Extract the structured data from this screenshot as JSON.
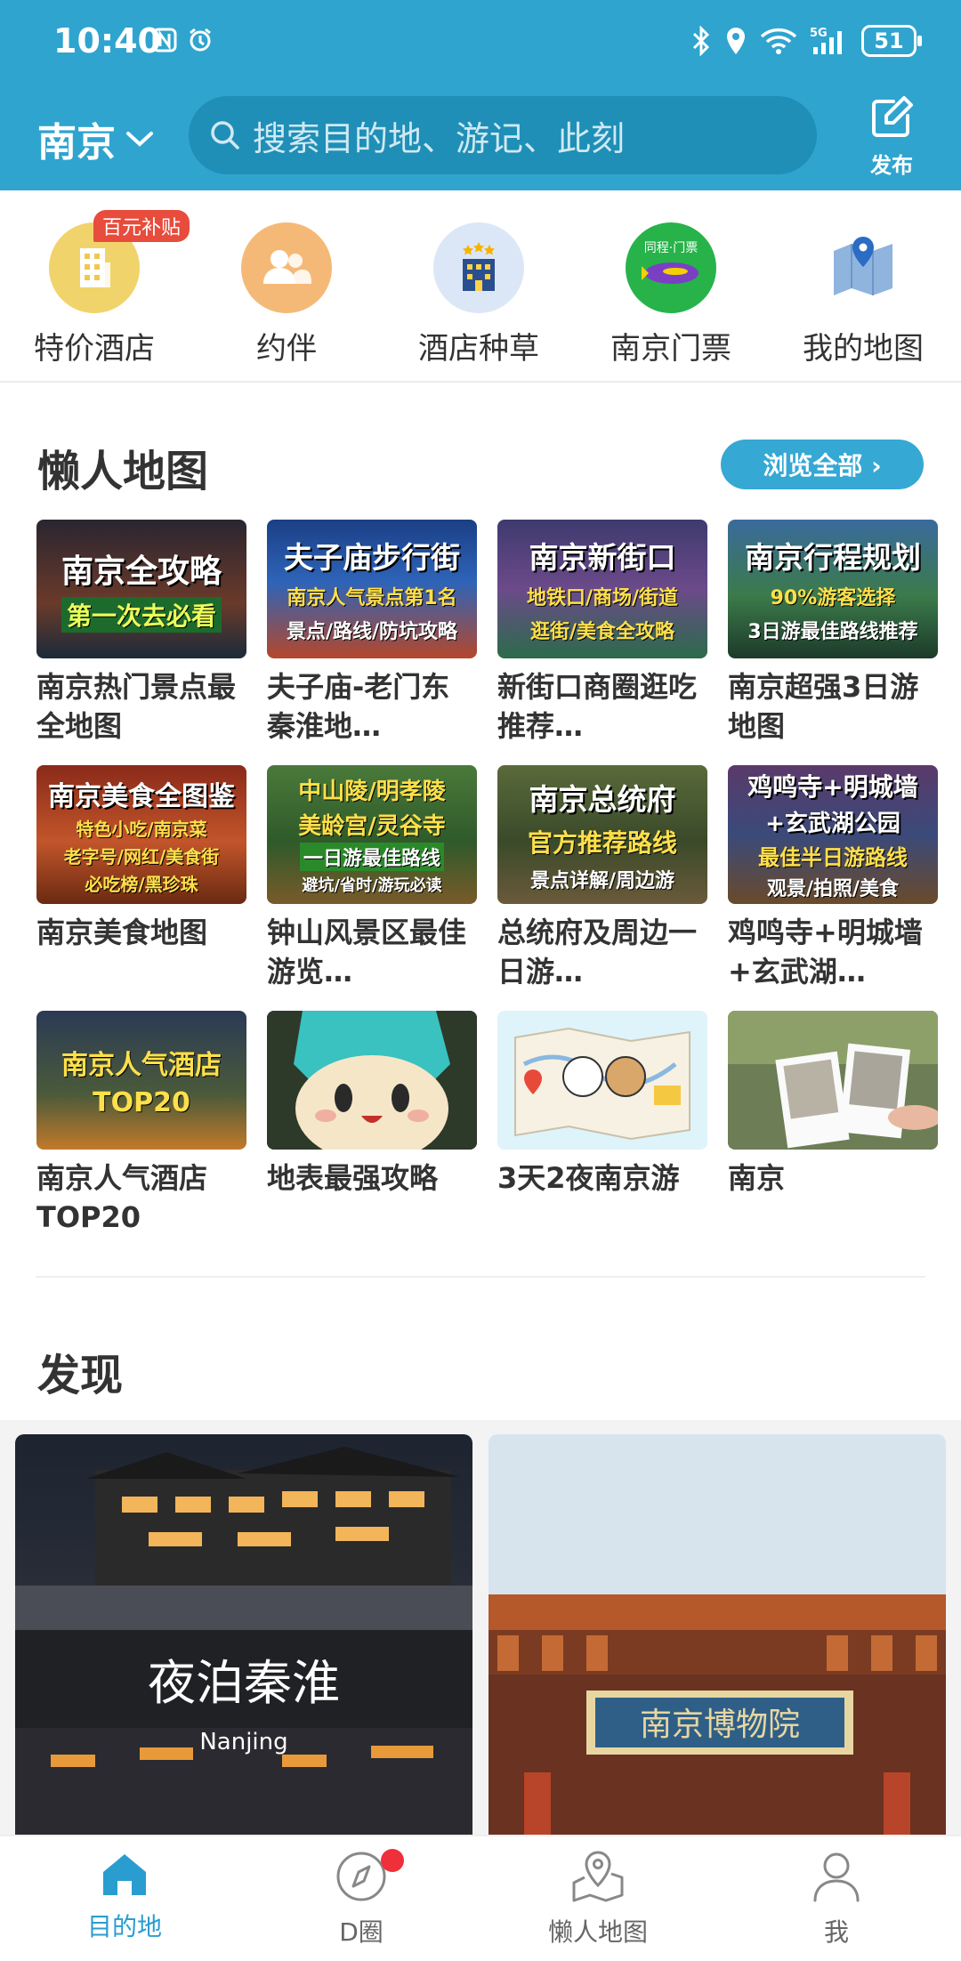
{
  "status_bar": {
    "time": "10:40",
    "battery": "51",
    "network": "5G"
  },
  "header": {
    "city": "南京",
    "search_placeholder": "搜索目的地、游记、此刻",
    "publish_label": "发布"
  },
  "categories": [
    {
      "label": "特价酒店",
      "badge": "百元补贴",
      "icon": "hotel-building-icon"
    },
    {
      "label": "约伴",
      "icon": "companions-icon"
    },
    {
      "label": "酒店种草",
      "icon": "hotel-stars-icon"
    },
    {
      "label": "南京门票",
      "icon": "ticket-airship-icon",
      "icon_text": "同程·门票"
    },
    {
      "label": "我的地图",
      "icon": "map-pin-icon"
    }
  ],
  "lazy_map": {
    "title": "懒人地图",
    "browse_all": "浏览全部 ›",
    "items": [
      {
        "title": "南京热门景点最全地图",
        "thumb": [
          "南京全攻略",
          "第一次去必看"
        ]
      },
      {
        "title": "夫子庙-老门东秦淮地…",
        "thumb": [
          "夫子庙步行街",
          "南京人气景点第1名",
          "景点/路线/防坑攻略"
        ]
      },
      {
        "title": "新街口商圈逛吃推荐…",
        "thumb": [
          "南京新街口",
          "地铁口/商场/街道",
          "逛街/美食全攻略"
        ]
      },
      {
        "title": "南京超强3日游地图",
        "thumb": [
          "南京行程规划",
          "90%游客选择",
          "3日游最佳路线推荐"
        ]
      },
      {
        "title": "南京美食地图",
        "thumb": [
          "南京美食全图鉴",
          "特色小吃/南京菜",
          "老字号/网红/美食街",
          "必吃榜/黑珍珠"
        ]
      },
      {
        "title": "钟山风景区最佳游览…",
        "thumb": [
          "中山陵/明孝陵",
          "美龄宫/灵谷寺",
          "一日游最佳路线",
          "避坑/省时/游玩必读"
        ]
      },
      {
        "title": "总统府及周边一日游…",
        "thumb": [
          "南京总统府",
          "官方推荐路线",
          "景点详解/周边游"
        ]
      },
      {
        "title": "鸡鸣寺+明城墙+玄武湖…",
        "thumb": [
          "鸡鸣寺+明城墙",
          "+玄武湖公园",
          "最佳半日游路线",
          "观景/拍照/美食"
        ]
      },
      {
        "title": "南京人气酒店TOP20",
        "thumb": [
          "南京人气酒店",
          "TOP20"
        ]
      },
      {
        "title": "地表最强攻略",
        "thumb": []
      },
      {
        "title": "3天2夜南京游",
        "thumb": []
      },
      {
        "title": "南京",
        "thumb": []
      }
    ]
  },
  "discover": {
    "title": "发现",
    "cards": [
      {
        "overlay_title": "夜泊秦淮",
        "overlay_sub": "Nanjing"
      },
      {
        "overlay_title": "南京博物院"
      }
    ]
  },
  "bottom_nav": [
    {
      "label": "目的地",
      "active": true,
      "icon": "home-icon"
    },
    {
      "label": "D圈",
      "icon": "compass-icon",
      "dot": true
    },
    {
      "label": "懒人地图",
      "icon": "map-location-icon"
    },
    {
      "label": "我",
      "icon": "user-icon"
    }
  ]
}
